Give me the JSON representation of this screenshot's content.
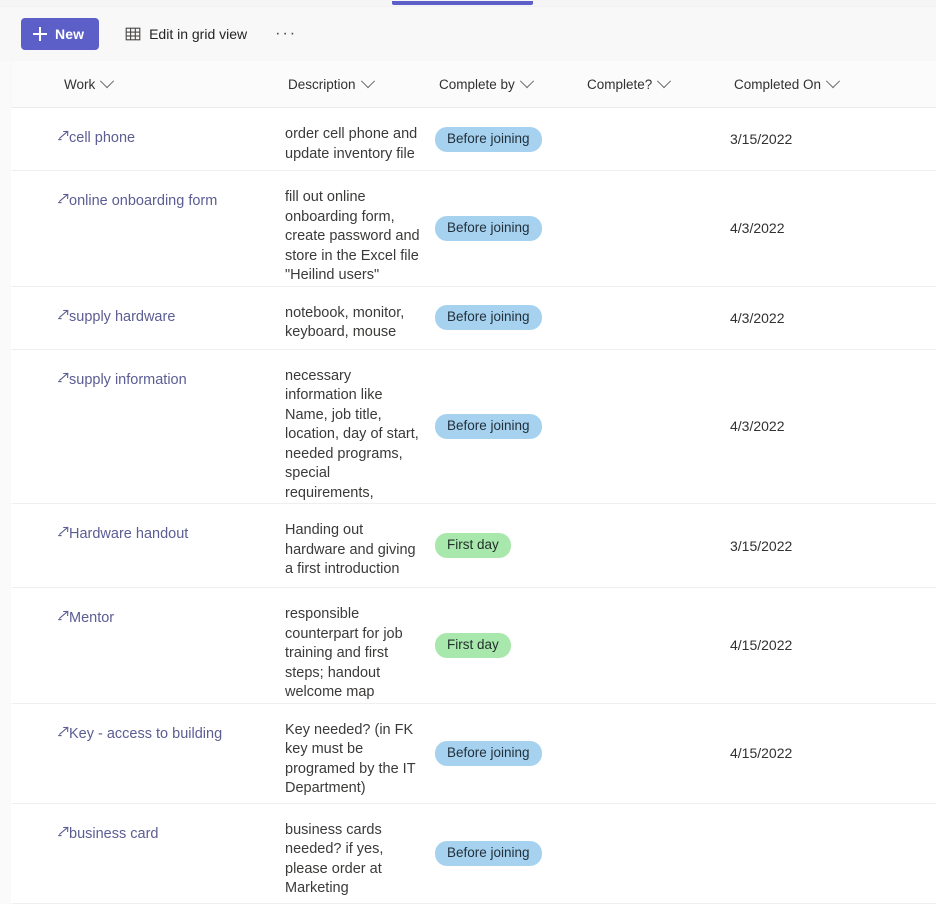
{
  "tab_strip": {
    "active_indicator_color": "#5b5fc7"
  },
  "toolbar": {
    "new_label": "New",
    "new_icon": "plus-icon",
    "edit_grid_label": "Edit in grid view",
    "edit_grid_icon": "grid-icon",
    "overflow_label": "···",
    "accent_color": "#5b5fc7"
  },
  "table": {
    "columns": [
      {
        "label": "Work",
        "key": "work"
      },
      {
        "label": "Description",
        "key": "description"
      },
      {
        "label": "Complete by",
        "key": "complete_by"
      },
      {
        "label": "Complete?",
        "key": "complete"
      },
      {
        "label": "Completed On",
        "key": "completed_on"
      }
    ],
    "row_icon": "open-item-icon",
    "pill_colors": {
      "before_joining_bg": "#a6d2ef",
      "first_day_bg": "#a8e8ac"
    },
    "rows": [
      {
        "work": "cell phone",
        "description": "order cell phone and update inventory file",
        "complete_by": "Before joining",
        "complete_by_style": "blue",
        "complete": "",
        "completed_on": "3/15/2022"
      },
      {
        "work": "online onboarding form",
        "description": "fill out online onboarding form, create password and store in the Excel file \"Heilind users\"",
        "complete_by": "Before joining",
        "complete_by_style": "blue",
        "complete": "",
        "completed_on": "4/3/2022"
      },
      {
        "work": "supply hardware",
        "description": "notebook, monitor, keyboard, mouse",
        "complete_by": "Before joining",
        "complete_by_style": "blue",
        "complete": "",
        "completed_on": "4/3/2022"
      },
      {
        "work": "supply information",
        "description": "necessary information like Name, job title, location, day of start, needed programs, special requirements,",
        "complete_by": "Before joining",
        "complete_by_style": "blue",
        "complete": "",
        "completed_on": "4/3/2022"
      },
      {
        "work": "Hardware handout",
        "description": "Handing out hardware and giving a first introduction",
        "complete_by": "First day",
        "complete_by_style": "green",
        "complete": "",
        "completed_on": "3/15/2022"
      },
      {
        "work": "Mentor",
        "description": "responsible counterpart for job training and first steps; handout welcome map",
        "complete_by": "First day",
        "complete_by_style": "green",
        "complete": "",
        "completed_on": "4/15/2022"
      },
      {
        "work": "Key - access to building",
        "description": "Key needed? (in FK key must be programed by the IT Department)",
        "complete_by": "Before joining",
        "complete_by_style": "blue",
        "complete": "",
        "completed_on": "4/15/2022"
      },
      {
        "work": "business card",
        "description": "business cards needed? if yes, please order at Marketing",
        "complete_by": "Before joining",
        "complete_by_style": "blue",
        "complete": "",
        "completed_on": ""
      }
    ]
  }
}
